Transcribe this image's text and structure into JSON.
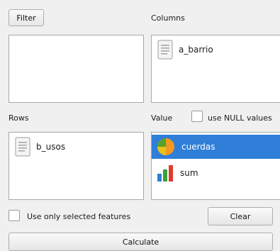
{
  "filter": {
    "button_label": "Filter"
  },
  "columns": {
    "label": "Columns",
    "items": [
      {
        "label": "a_barrio",
        "icon": "text-field-icon"
      }
    ]
  },
  "rows": {
    "label": "Rows",
    "items": [
      {
        "label": "b_usos",
        "icon": "text-field-icon"
      }
    ]
  },
  "value": {
    "label": "Value",
    "null_checkbox_label": "use NULL values",
    "null_checked": false,
    "items": [
      {
        "label": "cuerdas",
        "icon": "pie-chart-icon",
        "selected": true
      },
      {
        "label": "sum",
        "icon": "bar-chart-icon",
        "selected": false
      }
    ]
  },
  "options": {
    "selected_only_label": "Use only selected features",
    "selected_only_checked": false,
    "clear_label": "Clear",
    "calculate_label": "Calculate"
  },
  "colors": {
    "selection": "#2f7ed8",
    "selection_text": "#ffffff"
  }
}
